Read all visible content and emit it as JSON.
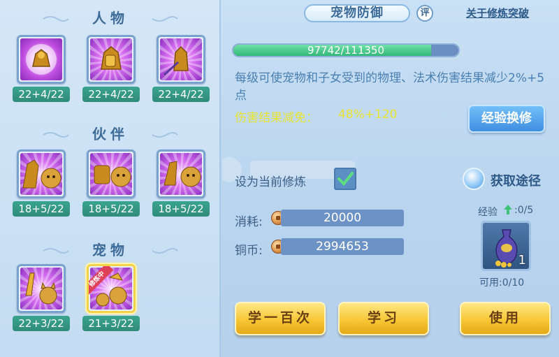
{
  "left": {
    "sections": [
      {
        "title": "人物",
        "skills": [
          {
            "level": "22+4/22"
          },
          {
            "level": "22+4/22"
          },
          {
            "level": "22+4/22"
          }
        ]
      },
      {
        "title": "伙伴",
        "skills": [
          {
            "level": "18+5/22"
          },
          {
            "level": "18+5/22"
          },
          {
            "level": "18+5/22"
          }
        ]
      },
      {
        "title": "宠物",
        "skills": [
          {
            "level": "22+3/22"
          },
          {
            "level": "21+3/22",
            "badge": "修炼中"
          }
        ]
      }
    ]
  },
  "header": {
    "title": "宠物防御",
    "rate_label": "评",
    "link": "关于修炼突破"
  },
  "progress": {
    "text": "97742/111350",
    "fraction": 0.878
  },
  "description": "每级可使宠物和子女受到的物理、法术伤害结果减少2%+5点",
  "reduction": {
    "label": "伤害结果减免：",
    "value": "48%+120"
  },
  "buttons": {
    "exchange": "经验换修",
    "learn_hundred": "学一百次",
    "learn": "学习",
    "use": "使用"
  },
  "set_current": "设为当前修炼",
  "source": "获取途径",
  "cost": {
    "label": "消耗:",
    "value": "20000"
  },
  "money": {
    "label": "铜币:",
    "value": "2994653"
  },
  "item": {
    "exp_label": "经验",
    "exp_count": ":0/5",
    "qty": "1",
    "available": "可用:0/10"
  },
  "colors": {
    "level_bar": "#3aa48f",
    "progress_fill": "#33b777",
    "highlight_text": "#e8e233",
    "gold_button": "#f7c735",
    "blue_button": "#3f8ee0"
  }
}
